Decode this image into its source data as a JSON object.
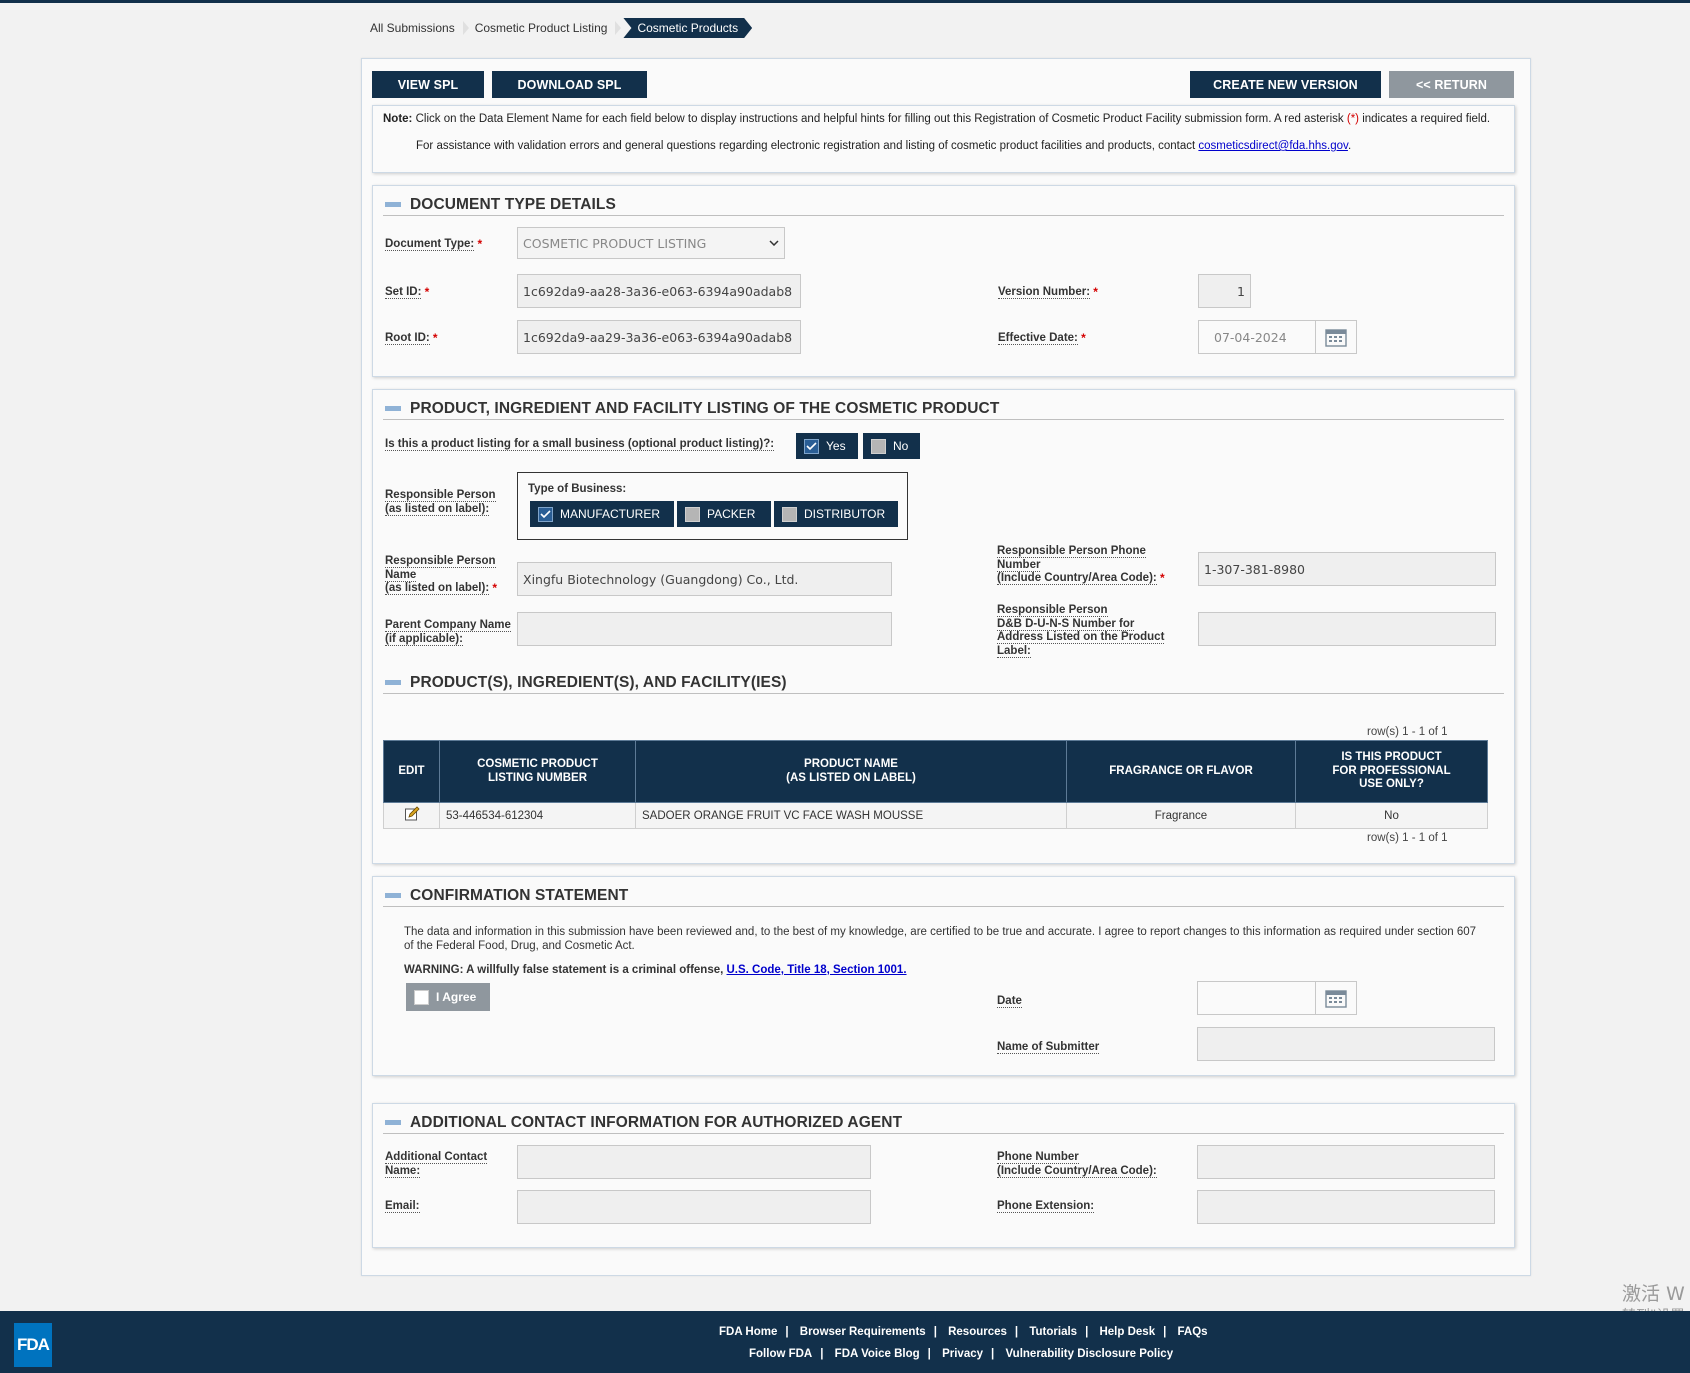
{
  "breadcrumb": [
    "All Submissions",
    "Cosmetic Product Listing",
    "Cosmetic Products"
  ],
  "toolbar": {
    "view_spl": "VIEW SPL",
    "download_spl": "DOWNLOAD SPL",
    "create_new_version": "CREATE NEW VERSION",
    "return": "<< RETURN"
  },
  "note": {
    "prefix": "Note:",
    "text": " Click on the Data Element Name for each field below to display instructions and helpful hints for filling out this Registration of Cosmetic Product Facility submission form. A red asterisk ",
    "asterisk": "(*)",
    "text2": " indicates a required field.",
    "assist": "For assistance with validation errors and general questions regarding electronic registration and listing of cosmetic product facilities and products, contact ",
    "email": "cosmeticsdirect@fda.hhs.gov",
    "period": "."
  },
  "doc_type": {
    "title": "DOCUMENT TYPE DETAILS",
    "document_type_label": "Document Type:",
    "document_type_value": "COSMETIC PRODUCT LISTING",
    "set_id_label": "Set ID:",
    "set_id_value": "1c692da9-aa28-3a36-e063-6394a90adab8",
    "root_id_label": "Root ID:",
    "root_id_value": "1c692da9-aa29-3a36-e063-6394a90adab8",
    "version_label": "Version Number:",
    "version_value": "1",
    "effective_label": "Effective Date:",
    "effective_value": "07-04-2024"
  },
  "listing": {
    "title": "PRODUCT, INGREDIENT AND FACILITY LISTING OF THE COSMETIC PRODUCT",
    "small_business_label": "Is this a product listing for a small business (optional product listing)?:",
    "yes": "Yes",
    "no": "No",
    "rp_label_1": "Responsible Person",
    "rp_label_2": "(as listed on label):",
    "type_of_business": "Type of Business:",
    "manufacturer": "MANUFACTURER",
    "packer": "PACKER",
    "distributor": "DISTRIBUTOR",
    "rp_name_label_1": "Responsible Person",
    "rp_name_label_2": "Name",
    "rp_name_label_3": "(as listed on label):",
    "rp_name_value": "Xingfu Biotechnology (Guangdong) Co., Ltd.",
    "phone_label_1": "Responsible Person Phone",
    "phone_label_2": "Number",
    "phone_label_3": "(Include Country/Area Code):",
    "phone_value": "1-307-381-8980",
    "parent_label_1": "Parent Company Name",
    "parent_label_2": "(if applicable):",
    "duns_label_1": "Responsible Person",
    "duns_label_2": "D&B D-U-N-S Number for",
    "duns_label_3": "Address Listed on the Product",
    "duns_label_4": "Label:"
  },
  "products": {
    "title": "PRODUCT(S), INGREDIENT(S), AND FACILITY(IES)",
    "rows_info": "row(s) 1 - 1 of 1",
    "headers": {
      "edit": "EDIT",
      "listing_1": "COSMETIC PRODUCT",
      "listing_2": "LISTING NUMBER",
      "name_1": "PRODUCT NAME",
      "name_2": "(AS LISTED ON LABEL)",
      "fragrance": "FRAGRANCE OR FLAVOR",
      "pro_1": "IS THIS PRODUCT",
      "pro_2": "FOR PROFESSIONAL",
      "pro_3": "USE ONLY?"
    },
    "row": {
      "listing_number": "53-446534-612304",
      "product_name": "SADOER ORANGE FRUIT VC FACE WASH MOUSSE",
      "fragrance": "Fragrance",
      "professional": "No"
    }
  },
  "confirmation": {
    "title": "CONFIRMATION STATEMENT",
    "statement": "The data and information in this submission have been reviewed and, to the best of my knowledge, are certified to be true and accurate. I agree to report changes to this information as required under section 607 of the Federal Food, Drug, and Cosmetic Act.",
    "warning": "WARNING: A willfully false statement is a criminal offense, ",
    "warning_link": "U.S. Code, Title 18, Section 1001.",
    "agree": "I Agree",
    "date_label": "Date",
    "submitter_label": "Name of Submitter"
  },
  "agent": {
    "title": "ADDITIONAL CONTACT INFORMATION FOR AUTHORIZED AGENT",
    "contact_label_1": "Additional Contact",
    "contact_label_2": "Name:",
    "email_label": "Email:",
    "phone_label_1": "Phone Number",
    "phone_label_2": "(Include Country/Area Code):",
    "ext_label": "Phone Extension:"
  },
  "footer": {
    "logo": "FDA",
    "line1": [
      "FDA Home",
      "Browser Requirements",
      "Resources",
      "Tutorials",
      "Help Desk",
      "FAQs"
    ],
    "line2": [
      "Follow FDA",
      "FDA Voice Blog",
      "Privacy",
      "Vulnerability Disclosure Policy"
    ],
    "separator": "|"
  },
  "watermark": {
    "line1": "激活 W",
    "line2": "转到\"设置"
  },
  "colors": {
    "navy": "#12304b",
    "gray_button": "#8f979e",
    "required_red": "#d40000",
    "link_blue": "#0000cc"
  }
}
